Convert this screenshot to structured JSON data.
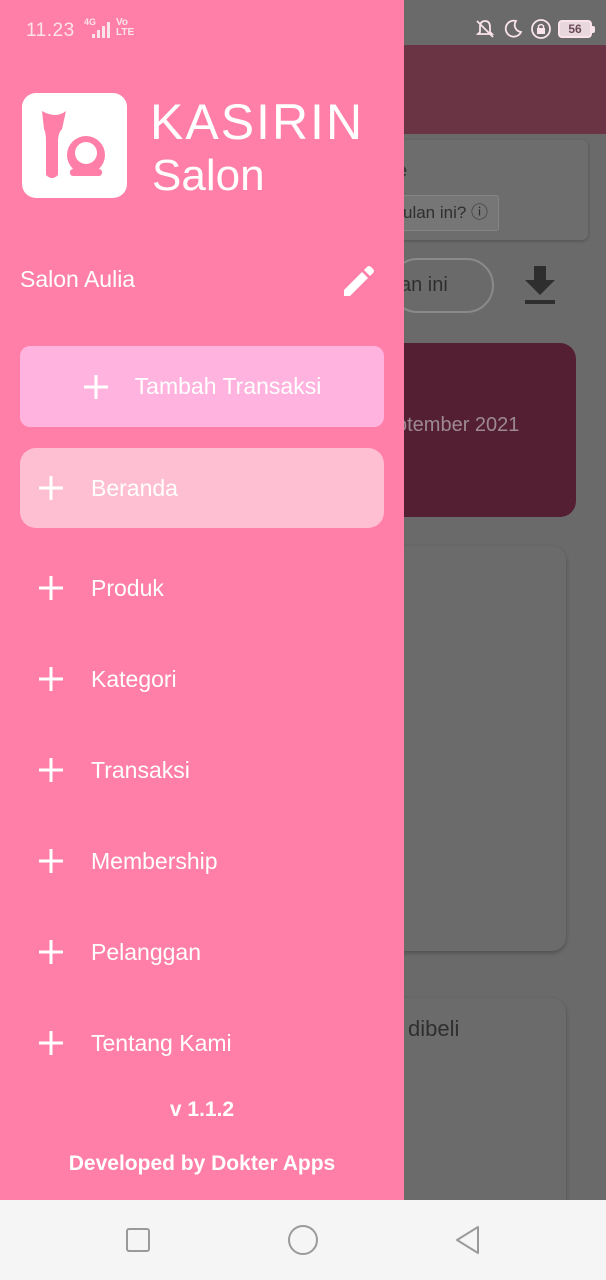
{
  "status_bar": {
    "time": "11.23",
    "network": "4G",
    "volte_top": "Vo",
    "volte_bottom": "LTE",
    "battery": "56",
    "icons": [
      "silent-icon",
      "moon-icon",
      "lock-icon",
      "battery-icon"
    ]
  },
  "background": {
    "info_title": "e",
    "info_chip": "ulan ini? ⓘ",
    "period_chip": "an ini",
    "sales_date": "otember 2021",
    "list_title": "dibeli"
  },
  "drawer": {
    "brand_title": "KASIRIN",
    "brand_subtitle": "Salon",
    "store_name": "Salon Aulia",
    "add_transaction_label": "Tambah Transaksi",
    "menu": [
      {
        "label": "Beranda",
        "active": true
      },
      {
        "label": "Produk",
        "active": false
      },
      {
        "label": "Kategori",
        "active": false
      },
      {
        "label": "Transaksi",
        "active": false
      },
      {
        "label": "Membership",
        "active": false
      },
      {
        "label": "Pelanggan",
        "active": false
      },
      {
        "label": "Tentang Kami",
        "active": false
      }
    ],
    "version": "v 1.1.2",
    "developer": "Developed by Dokter Apps"
  },
  "colors": {
    "drawer_bg": "#ff7fa8",
    "add_button_bg": "#ffb3de",
    "active_item_bg": "#ffbfd2",
    "header_dim": "#6b3444",
    "sales_card_dim": "#551f33"
  }
}
